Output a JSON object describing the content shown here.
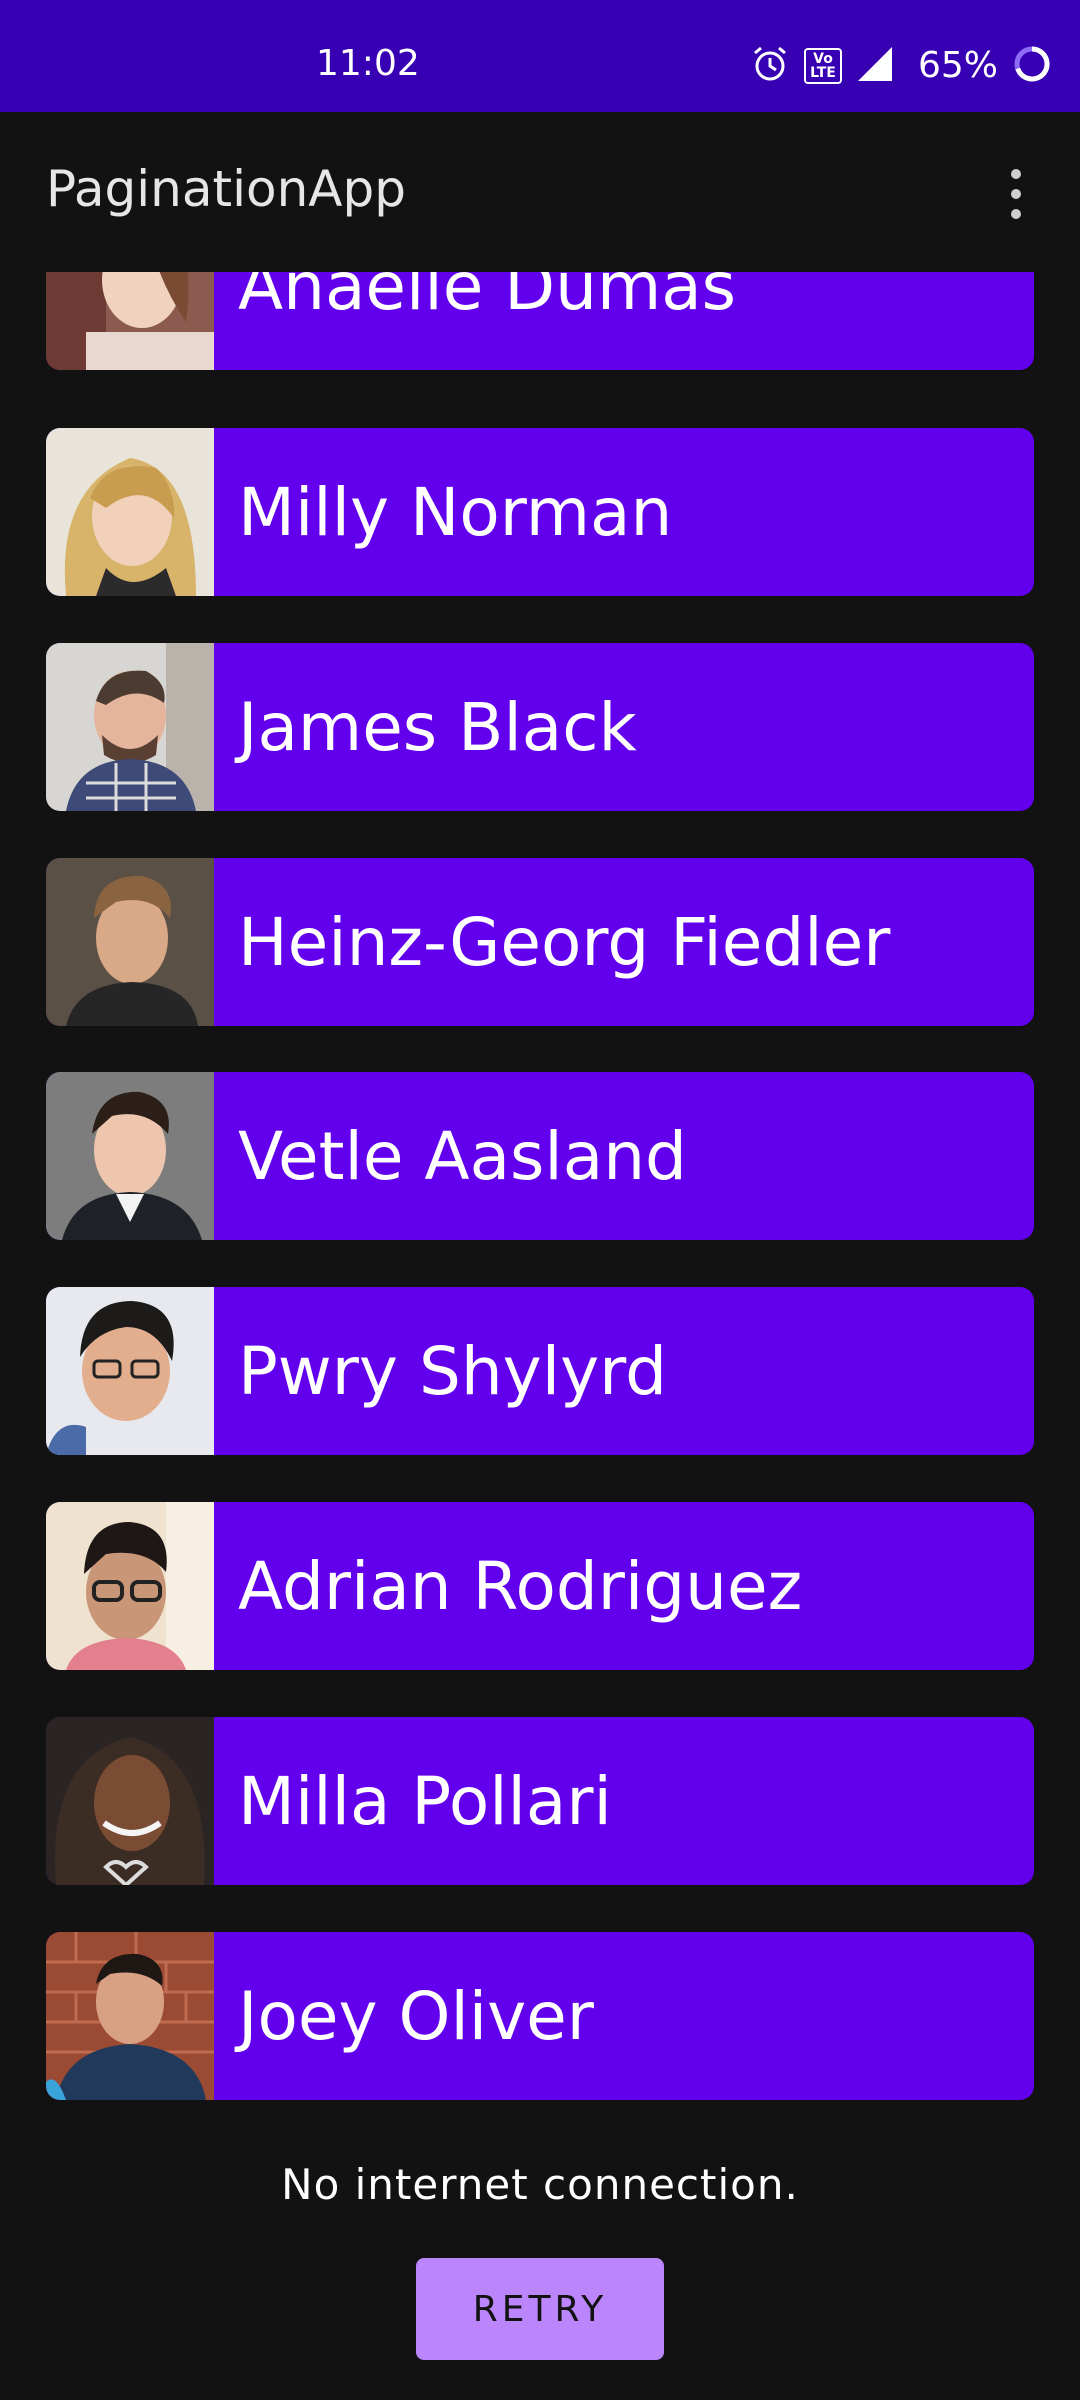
{
  "status_bar": {
    "time": "11:02",
    "battery": "65%",
    "icons": [
      "alarm-icon",
      "volte-icon",
      "signal-icon",
      "battery-icon"
    ],
    "volte_label": "Vo LTE"
  },
  "app_bar": {
    "title": "PaginationApp",
    "menu_icon": "more-vert-icon"
  },
  "users": [
    {
      "name": "Anaelle Dumas"
    },
    {
      "name": "Milly Norman"
    },
    {
      "name": "James Black"
    },
    {
      "name": "Heinz-Georg Fiedler"
    },
    {
      "name": "Vetle Aasland"
    },
    {
      "name": "Pwry Shylyrd"
    },
    {
      "name": "Adrian Rodriguez"
    },
    {
      "name": "Milla Pollari"
    },
    {
      "name": "Joey Oliver"
    }
  ],
  "error": {
    "message": "No internet connection.",
    "retry_label": "RETRY"
  },
  "colors": {
    "status_bar": "#3700b3",
    "background": "#121212",
    "card": "#6200ee",
    "button": "#bb86fc"
  }
}
